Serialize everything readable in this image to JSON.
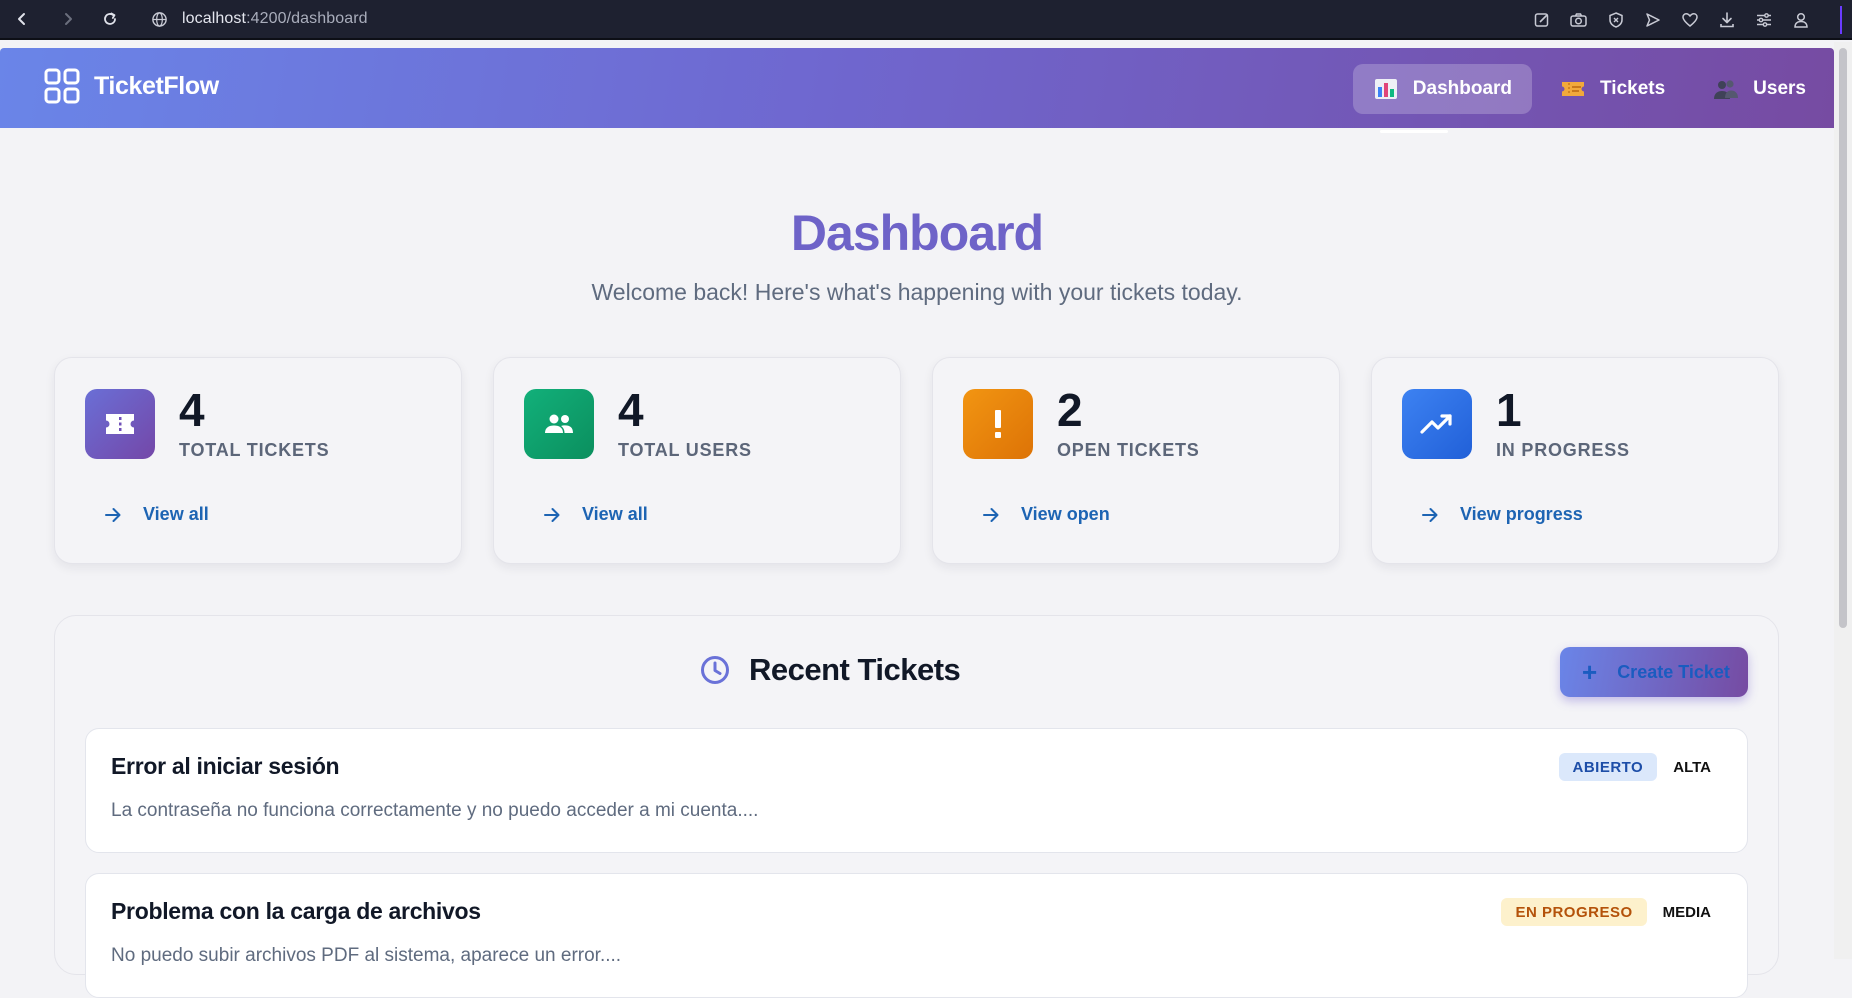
{
  "browser": {
    "url_host": "localhost",
    "url_path": ":4200/dashboard"
  },
  "header": {
    "brand": "TicketFlow",
    "nav": [
      {
        "label": "Dashboard",
        "icon": "chart-icon",
        "active": true
      },
      {
        "label": "Tickets",
        "icon": "ticket-icon",
        "active": false
      },
      {
        "label": "Users",
        "icon": "users-icon",
        "active": false
      }
    ]
  },
  "main": {
    "title": "Dashboard",
    "subtitle": "Welcome back! Here's what's happening with your tickets today."
  },
  "stats": [
    {
      "value": "4",
      "label": "TOTAL TICKETS",
      "link": "View all",
      "icon": "ticket-icon",
      "color": "#6e5bc7"
    },
    {
      "value": "4",
      "label": "TOTAL USERS",
      "link": "View all",
      "icon": "people-icon",
      "color": "#10a36d"
    },
    {
      "value": "2",
      "label": "OPEN TICKETS",
      "link": "View open",
      "icon": "exclamation-icon",
      "color": "#e37d0a"
    },
    {
      "value": "1",
      "label": "IN PROGRESS",
      "link": "View progress",
      "icon": "trending-up-icon",
      "color": "#2d72e8"
    }
  ],
  "recent": {
    "title": "Recent Tickets",
    "create_label": "Create Ticket",
    "tickets": [
      {
        "title": "Error al iniciar sesión",
        "description": "La contraseña no funciona correctamente y no puedo acceder a mi cuenta....",
        "status": "ABIERTO",
        "status_bg": "#dbe8fb",
        "status_fg": "#1d4ea8",
        "priority": "ALTA"
      },
      {
        "title": "Problema con la carga de archivos",
        "description": "No puedo subir archivos PDF al sistema, aparece un error....",
        "status": "EN PROGRESO",
        "status_bg": "#fdf1cc",
        "status_fg": "#b4520a",
        "priority": "MEDIA"
      }
    ]
  }
}
